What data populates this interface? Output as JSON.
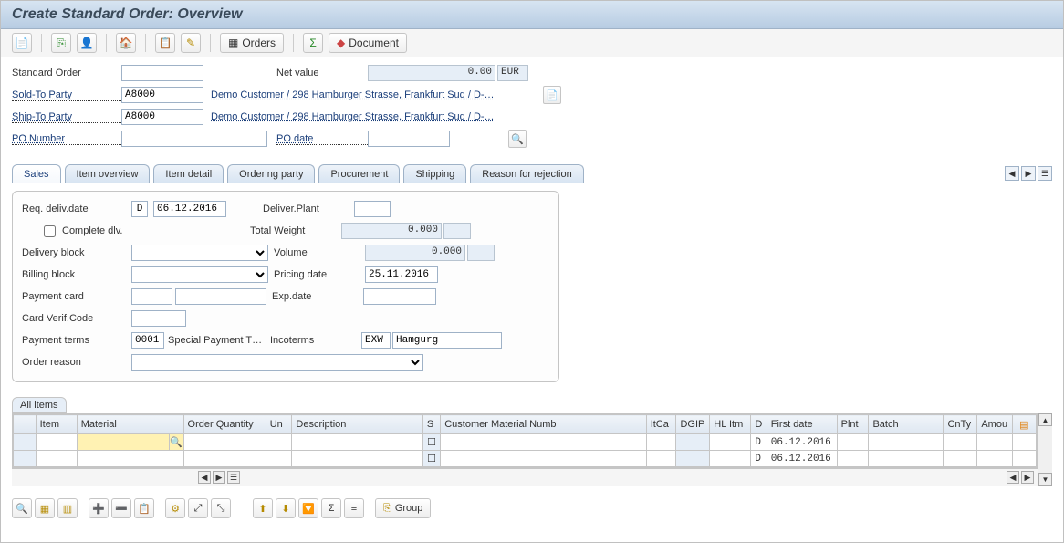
{
  "title": "Create Standard Order: Overview",
  "toolbar": {
    "orders_label": "Orders",
    "document_label": "Document"
  },
  "header": {
    "standard_order_label": "Standard Order",
    "standard_order_value": "",
    "net_value_label": "Net value",
    "net_value": "0.00",
    "currency": "EUR",
    "sold_to_party_label": "Sold-To Party",
    "sold_to_party_value": "A8000",
    "sold_to_party_text": "Demo Customer / 298 Hamburger Strasse, Frankfurt Sud / D-…",
    "ship_to_party_label": "Ship-To Party",
    "ship_to_party_value": "A8000",
    "ship_to_party_text": "Demo Customer / 298 Hamburger Strasse, Frankfurt Sud / D-…",
    "po_number_label": "PO Number",
    "po_number_value": "",
    "po_date_label": "PO date",
    "po_date_value": ""
  },
  "tabs": [
    "Sales",
    "Item overview",
    "Item detail",
    "Ordering party",
    "Procurement",
    "Shipping",
    "Reason for rejection"
  ],
  "sales": {
    "req_deliv_date_label": "Req. deliv.date",
    "req_deliv_type": "D",
    "req_deliv_date": "06.12.2016",
    "deliver_plant_label": "Deliver.Plant",
    "deliver_plant": "",
    "complete_dlv_label": "Complete dlv.",
    "complete_dlv": false,
    "total_weight_label": "Total Weight",
    "total_weight": "0.000",
    "delivery_block_label": "Delivery block",
    "delivery_block": "",
    "volume_label": "Volume",
    "volume": "0.000",
    "billing_block_label": "Billing block",
    "billing_block": "",
    "pricing_date_label": "Pricing date",
    "pricing_date": "25.11.2016",
    "payment_card_label": "Payment card",
    "payment_card": "",
    "exp_date_label": "Exp.date",
    "exp_date": "",
    "card_verif_label": "Card Verif.Code",
    "card_verif": "",
    "payment_terms_label": "Payment terms",
    "payment_terms_code": "0001",
    "payment_terms_text": "Special Payment T…",
    "incoterms_label": "Incoterms",
    "incoterms_code": "EXW",
    "incoterms_text": "Hamgurg",
    "order_reason_label": "Order reason",
    "order_reason": ""
  },
  "grid_title": "All items",
  "columns": [
    "Item",
    "Material",
    "Order Quantity",
    "Un",
    "Description",
    "S",
    "Customer Material Numb",
    "ItCa",
    "DGIP",
    "HL Itm",
    "D",
    "First date",
    "Plnt",
    "Batch",
    "CnTy",
    "Amou"
  ],
  "rows": [
    {
      "Item": "",
      "Material": "",
      "Order Quantity": "",
      "Un": "",
      "Description": "",
      "S": "",
      "Customer Material Numb": "",
      "ItCa": "",
      "DGIP": "",
      "HL Itm": "",
      "D": "D",
      "First date": "06.12.2016",
      "Plnt": "",
      "Batch": "",
      "CnTy": "",
      "Amou": ""
    },
    {
      "Item": "",
      "Material": "",
      "Order Quantity": "",
      "Un": "",
      "Description": "",
      "S": "",
      "Customer Material Numb": "",
      "ItCa": "",
      "DGIP": "",
      "HL Itm": "",
      "D": "D",
      "First date": "06.12.2016",
      "Plnt": "",
      "Batch": "",
      "CnTy": "",
      "Amou": ""
    }
  ],
  "bottom": {
    "group_label": "Group"
  }
}
